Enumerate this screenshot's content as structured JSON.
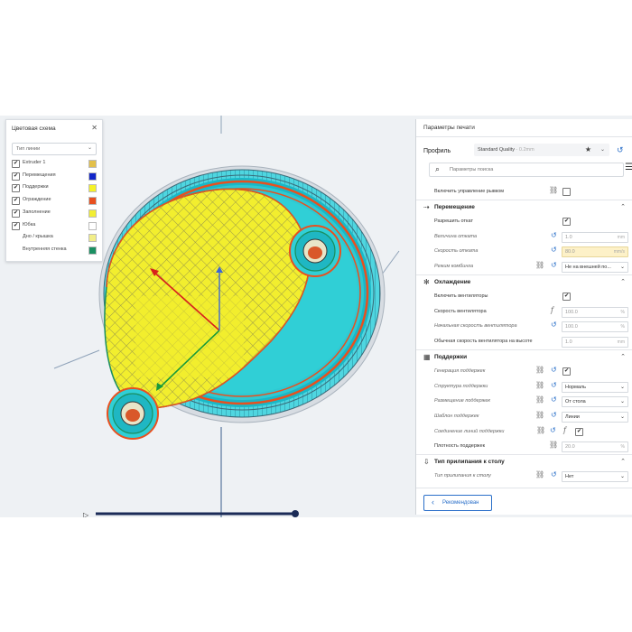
{
  "color_scheme_panel": {
    "title": "Цветовая схема",
    "dropdown_value": "Тип линии",
    "items": [
      {
        "label": "Extruder 1",
        "checked": true,
        "color": "#e3c04a"
      },
      {
        "label": "Перемещения",
        "checked": true,
        "color": "#1226c8"
      },
      {
        "label": "Поддержки",
        "checked": true,
        "color": "#f5f227"
      },
      {
        "label": "Ограждение",
        "checked": true,
        "color": "#e8501f"
      },
      {
        "label": "Заполнение",
        "checked": true,
        "color": "#f2ee33"
      },
      {
        "label": "Юбка",
        "checked": true,
        "color": "#ffffff"
      },
      {
        "label": "Дно / крышка",
        "checked": false,
        "color": "#f2ee88"
      },
      {
        "label": "Внутренняя стенка",
        "checked": false,
        "color": "#1a8f62"
      }
    ]
  },
  "print_settings": {
    "title": "Параметры печати",
    "profile_label": "Профиль",
    "profile_value": "Standard Quality",
    "profile_sub": "- 0.2mm",
    "search_placeholder": "Параметры поиска",
    "recommended_button": "Рекомендован",
    "sections": {
      "top": {
        "rows": [
          {
            "label": "Включить управление рывком",
            "italic": false,
            "check": false
          }
        ]
      },
      "travel": {
        "title": "Перемещение",
        "rows": [
          {
            "label": "Разрешить откат",
            "check": true
          },
          {
            "label": "Величина отката",
            "value": "1.0",
            "unit": "mm"
          },
          {
            "label": "Скорость отката",
            "value": "80.0",
            "unit": "mm/s"
          },
          {
            "label": "Режим комбинга",
            "value": "Не на внешней по..."
          }
        ]
      },
      "cooling": {
        "title": "Охлаждение",
        "rows": [
          {
            "label": "Включить вентиляторы",
            "check": true
          },
          {
            "label": "Скорость вентилятора",
            "value": "100.0",
            "unit": "%"
          },
          {
            "label": "Начальная скорость вентилятора",
            "value": "100.0",
            "unit": "%"
          },
          {
            "label": "Обычная скорость вентилятора на высоте",
            "value": "1.0",
            "unit": "mm"
          }
        ]
      },
      "support": {
        "title": "Поддержки",
        "rows": [
          {
            "label": "Генерация поддержек",
            "check": true
          },
          {
            "label": "Структура поддержки",
            "value": "Нормаль"
          },
          {
            "label": "Размещение поддержек",
            "value": "От стола"
          },
          {
            "label": "Шаблон поддержек",
            "value": "Линии"
          },
          {
            "label": "Соединение линий поддержки",
            "check": true
          },
          {
            "label": "Плотность поддержек",
            "value": "20.0",
            "unit": "%"
          }
        ]
      },
      "adhesion": {
        "title": "Тип прилипания к столу",
        "rows": [
          {
            "label": "Тип прилипания к столу",
            "value": "Нет"
          }
        ]
      }
    }
  }
}
